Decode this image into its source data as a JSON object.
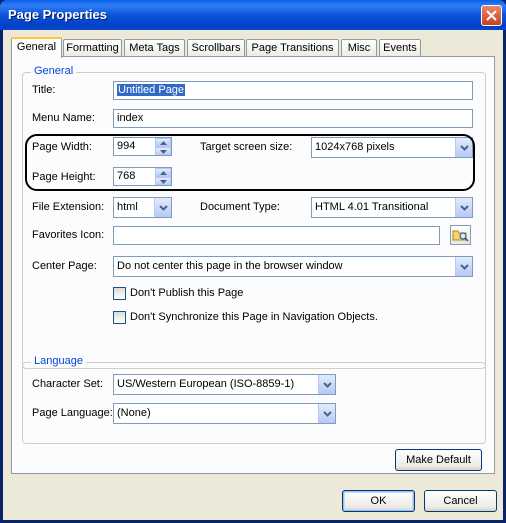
{
  "window": {
    "title": "Page Properties"
  },
  "tabs": [
    "General",
    "Formatting",
    "Meta Tags",
    "Scrollbars",
    "Page Transitions",
    "Misc",
    "Events"
  ],
  "general": {
    "group_label": "General",
    "title_label": "Title:",
    "title_value": "Untitled Page",
    "menu_name_label": "Menu Name:",
    "menu_name_value": "index",
    "page_width_label": "Page Width:",
    "page_width_value": "994",
    "page_height_label": "Page Height:",
    "page_height_value": "768",
    "target_screen_label": "Target screen size:",
    "target_screen_value": "1024x768 pixels",
    "file_ext_label": "File Extension:",
    "file_ext_value": "html",
    "doc_type_label": "Document Type:",
    "doc_type_value": "HTML 4.01 Transitional",
    "favicon_label": "Favorites Icon:",
    "favicon_value": "",
    "center_label": "Center Page:",
    "center_value": "Do not center this page in the browser window",
    "dont_publish_label": "Don't Publish this Page",
    "dont_publish_checked": false,
    "dont_sync_label": "Don't Synchronize this Page in Navigation Objects.",
    "dont_sync_checked": false
  },
  "language": {
    "group_label": "Language",
    "charset_label": "Character Set:",
    "charset_value": "US/Western European (ISO-8859-1)",
    "page_lang_label": "Page Language:",
    "page_lang_value": "(None)"
  },
  "buttons": {
    "make_default": "Make Default",
    "ok": "OK",
    "cancel": "Cancel"
  },
  "icons": {
    "close": "close-icon",
    "browse": "folder-browse-icon",
    "dropdown": "chevron-down-icon",
    "spinner": "spinner-arrows-icon"
  }
}
